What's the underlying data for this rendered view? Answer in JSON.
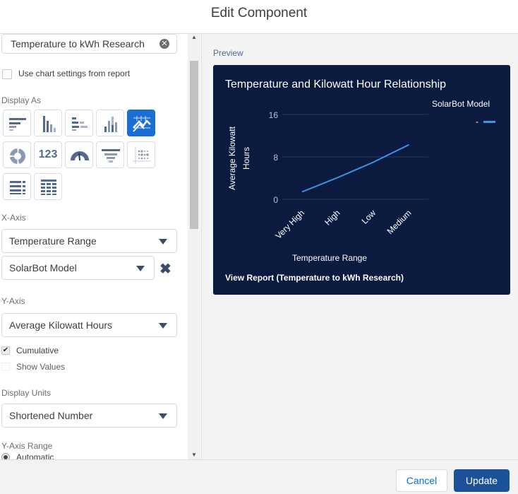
{
  "header": {
    "title": "Edit Component"
  },
  "left": {
    "report_value": "Temperature to kWh Research",
    "use_chart_settings_label": "Use chart settings from report",
    "display_as_label": "Display As",
    "chart_types": [
      "horizontal-bar",
      "vertical-bar",
      "stacked-horizontal-bar",
      "stacked-vertical-bar",
      "line",
      "donut",
      "metric",
      "gauge",
      "funnel",
      "scatter",
      "lightning-table",
      "table"
    ],
    "selected_chart_type": "line",
    "metric_text": "123",
    "x_axis_label": "X-Axis",
    "x_axis_value": "Temperature Range",
    "group_by_value": "SolarBot Model",
    "y_axis_label": "Y-Axis",
    "y_axis_value": "Average Kilowatt Hours",
    "cumulative_label": "Cumulative",
    "show_values_label": "Show Values",
    "display_units_label": "Display Units",
    "display_units_value": "Shortened Number",
    "y_axis_range_label": "Y-Axis Range",
    "automatic_label": "Automatic"
  },
  "preview": {
    "label": "Preview",
    "view_report": "View Report (Temperature to kWh Research)"
  },
  "chart_data": {
    "type": "line",
    "title": "Temperature and Kilowatt Hour Relationship",
    "xlabel": "Temperature Range",
    "ylabel_line1": "Average Kilowatt",
    "ylabel_line2": "Hours",
    "categories": [
      "Very High",
      "High",
      "Low",
      "Medium"
    ],
    "series": [
      {
        "name": "-",
        "values": [
          1.4,
          4.1,
          7.0,
          10.3
        ],
        "color": "#3a95e8"
      }
    ],
    "legend_title": "SolarBot Model",
    "legend_placement": "top-right",
    "ylim": [
      0,
      16
    ],
    "yticks": [
      "0",
      "8",
      "16"
    ],
    "grid": true
  },
  "footer": {
    "cancel": "Cancel",
    "update": "Update"
  },
  "colors": {
    "chart_bg": "#0b1a3f",
    "accent": "#1b5297",
    "selected_icon": "#1b6ed3"
  }
}
